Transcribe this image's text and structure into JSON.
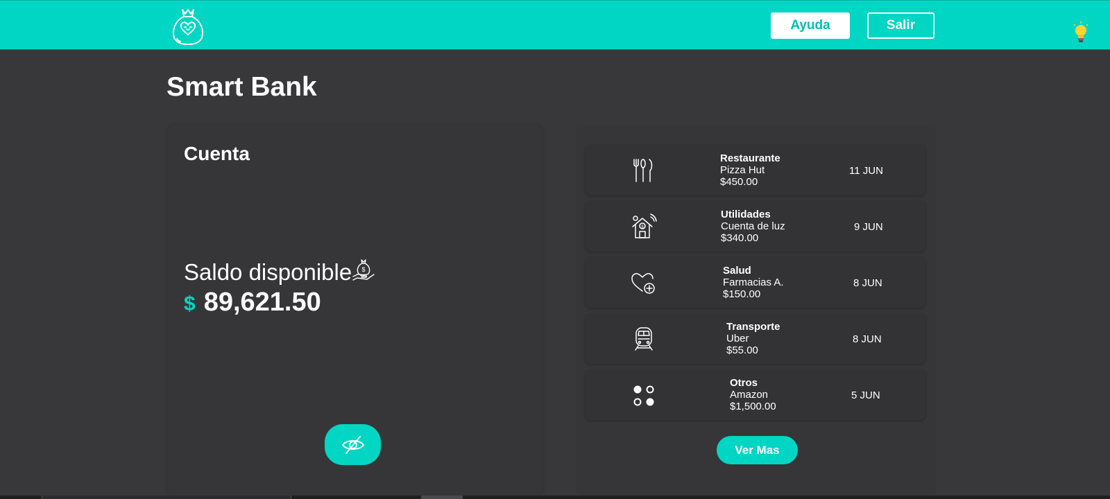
{
  "header": {
    "help_label": "Ayuda",
    "exit_label": "Salir",
    "accent_color": "#00d6c3",
    "logo_icon": "money-bag-heart-icon",
    "theme_icon": "lightbulb-icon"
  },
  "app": {
    "title": "Smart Bank"
  },
  "account": {
    "title": "Cuenta",
    "balance_label": "Saldo disponible",
    "currency_symbol": "$",
    "balance": "89,621.50",
    "toggle_icon": "eye-slash-icon"
  },
  "transactions": [
    {
      "icon": "cutlery-icon",
      "category": "Restaurante",
      "merchant": "Pizza Hut",
      "amount": "$450.00",
      "date": "11 JUN"
    },
    {
      "icon": "house-bill-icon",
      "category": "Utilidades",
      "merchant": "Cuenta de luz",
      "amount": "$340.00",
      "date": "9 JUN"
    },
    {
      "icon": "heart-health-icon",
      "category": "Salud",
      "merchant": "Farmacias A.",
      "amount": "$150.00",
      "date": "8 JUN"
    },
    {
      "icon": "train-icon",
      "category": "Transporte",
      "merchant": "Uber",
      "amount": "$55.00",
      "date": "8 JUN"
    },
    {
      "icon": "dots-grid-icon",
      "category": "Otros",
      "merchant": "Amazon",
      "amount": "$1,500.00",
      "date": "5 JUN"
    }
  ],
  "see_more_label": "Ver Mas"
}
